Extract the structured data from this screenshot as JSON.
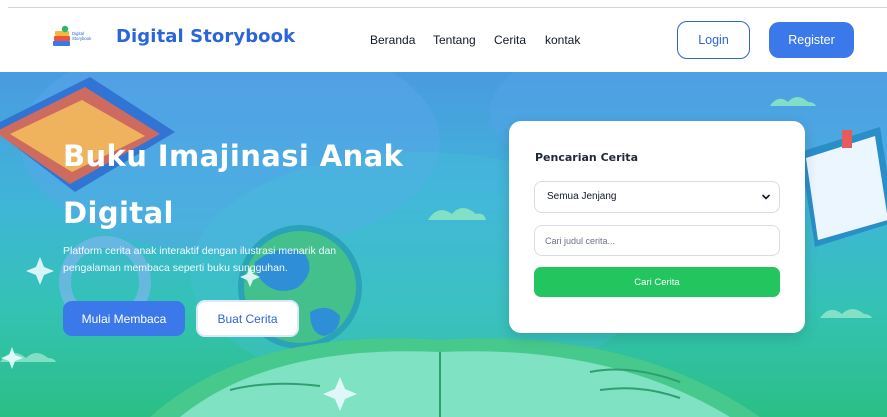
{
  "header": {
    "brand": "Digital Storybook",
    "logo_text_line1": "Digital",
    "logo_text_line2": "Storybook",
    "nav": [
      "Beranda",
      "Tentang",
      "Cerita",
      "kontak"
    ],
    "login_label": "Login",
    "register_label": "Register"
  },
  "hero": {
    "title_line1": "Buku Imajinasi Anak",
    "title_line2": "Digital",
    "description": "Platform cerita anak interaktif dengan ilustrasi menarik dan pengalaman membaca seperti buku sungguhan.",
    "primary_button": "Mulai Membaca",
    "secondary_button": "Buat Cerita"
  },
  "search": {
    "title": "Pencarian Cerita",
    "level_selected": "Semua Jenjang",
    "input_placeholder": "Cari judul cerita...",
    "button_label": "Cari Cerita"
  },
  "colors": {
    "primary": "#2b66d9",
    "button_blue": "#3b78ea",
    "success": "#22c55e",
    "hero_top": "#4a9be0",
    "hero_bottom": "#2bbf85"
  }
}
